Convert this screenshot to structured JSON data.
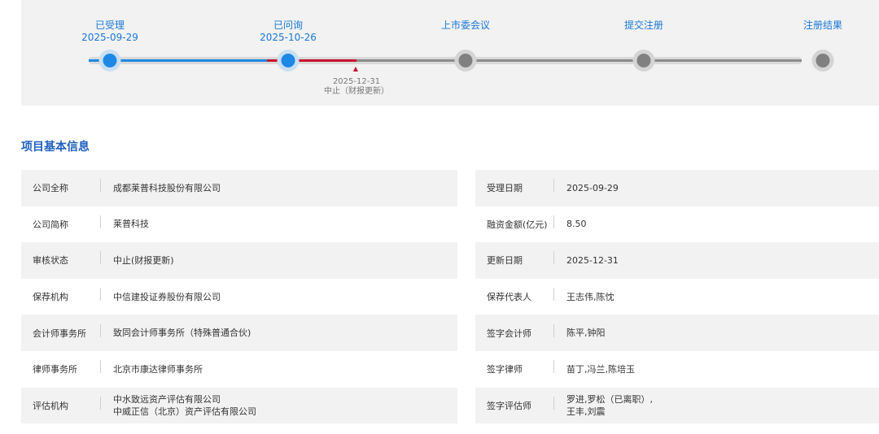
{
  "progress": {
    "stages": [
      {
        "name": "已受理",
        "date": "2025-09-29"
      },
      {
        "name": "已问询",
        "date": "2025-10-26"
      },
      {
        "name": "上市委会议",
        "date": ""
      },
      {
        "name": "提交注册",
        "date": ""
      },
      {
        "name": "注册结果",
        "date": ""
      }
    ],
    "suspend_date": "2025-12-31",
    "suspend_label": "中止（财报更新）"
  },
  "section_title": "项目基本信息",
  "left_rows": [
    {
      "label": "公司全称",
      "value": "成都莱普科技股份有限公司"
    },
    {
      "label": "公司简称",
      "value": "莱普科技"
    },
    {
      "label": "审核状态",
      "value": "中止(财报更新)"
    },
    {
      "label": "保荐机构",
      "value": "中信建投证券股份有限公司"
    },
    {
      "label": "会计师事务所",
      "value": "致同会计师事务所（特殊普通合伙)"
    },
    {
      "label": "律师事务所",
      "value": "北京市康达律师事务所"
    },
    {
      "label": "评估机构",
      "value": "中水致远资产评估有限公司",
      "value2": "中威正信（北京）资产评估有限公司"
    }
  ],
  "right_rows": [
    {
      "label": "受理日期",
      "value": "2025-09-29"
    },
    {
      "label": "融资金额(亿元)",
      "value": "8.50"
    },
    {
      "label": "更新日期",
      "value": "2025-12-31"
    },
    {
      "label": "保荐代表人",
      "value": "王志伟,陈忱"
    },
    {
      "label": "签字会计师",
      "value": "陈平,钟阳"
    },
    {
      "label": "签字律师",
      "value": "苗丁,冯兰,陈培玉"
    },
    {
      "label": "签字评估师",
      "value": "罗进,罗松（已离职）,",
      "value2": "王丰,刘震"
    }
  ]
}
